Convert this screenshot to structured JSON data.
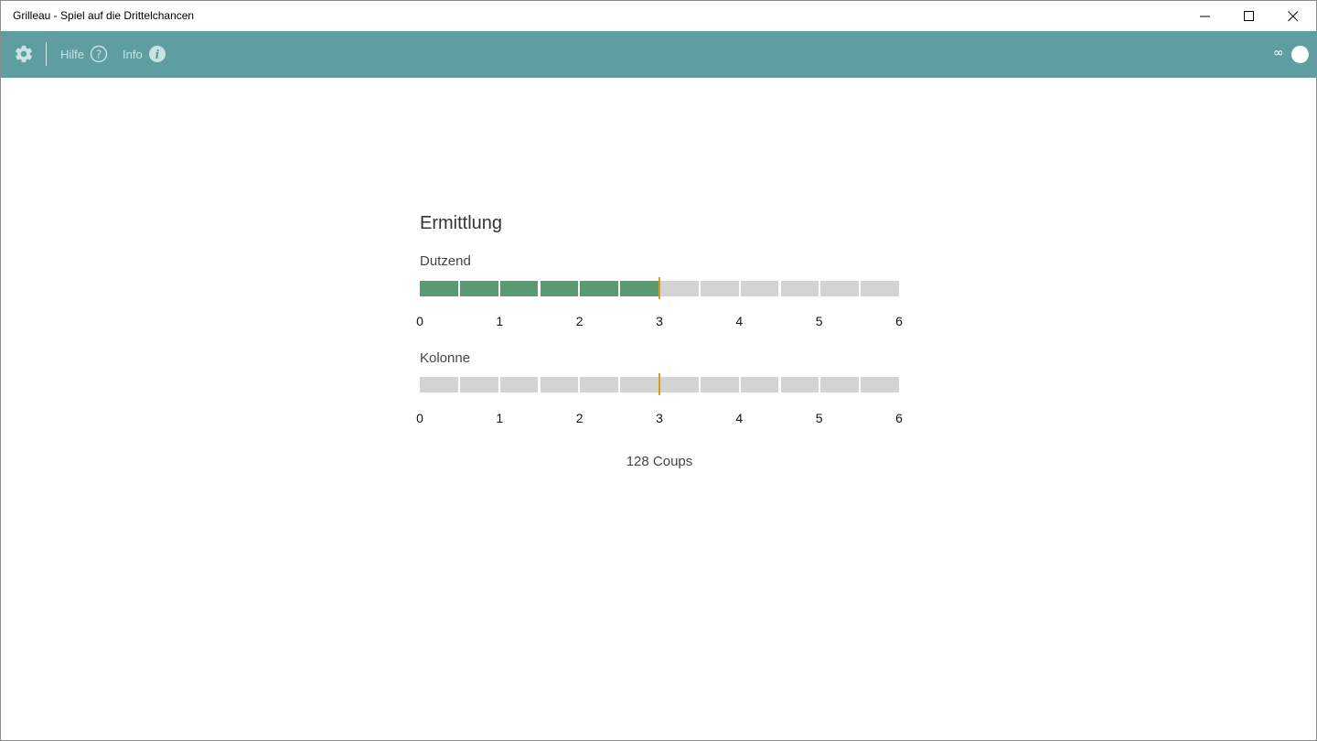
{
  "window": {
    "title": "Grilleau - Spiel auf die Drittelchancen"
  },
  "toolbar": {
    "settings_icon": "gear-icon",
    "help_label": "Hilfe",
    "help_icon": "question-circle-icon",
    "info_label": "Info",
    "info_icon": "info-circle-icon",
    "mode_symbol": "∞",
    "toggle_icon": "toggle-dot-icon",
    "bar_color": "#5e9ea0"
  },
  "main": {
    "title": "Ermittlung",
    "meters": [
      {
        "label": "Dutzend",
        "segments_total": 12,
        "segments_filled": 6,
        "marker_value": 3,
        "scale_max": 6,
        "ticks": [
          "0",
          "1",
          "2",
          "3",
          "4",
          "5",
          "6"
        ]
      },
      {
        "label": "Kolonne",
        "segments_total": 12,
        "segments_filled": 0,
        "marker_value": 3,
        "scale_max": 6,
        "ticks": [
          "0",
          "1",
          "2",
          "3",
          "4",
          "5",
          "6"
        ]
      }
    ],
    "coups_text": "128 Coups",
    "colors": {
      "filled": "#5a9a72",
      "empty": "#d3d3d3",
      "marker": "#d4a017"
    }
  }
}
